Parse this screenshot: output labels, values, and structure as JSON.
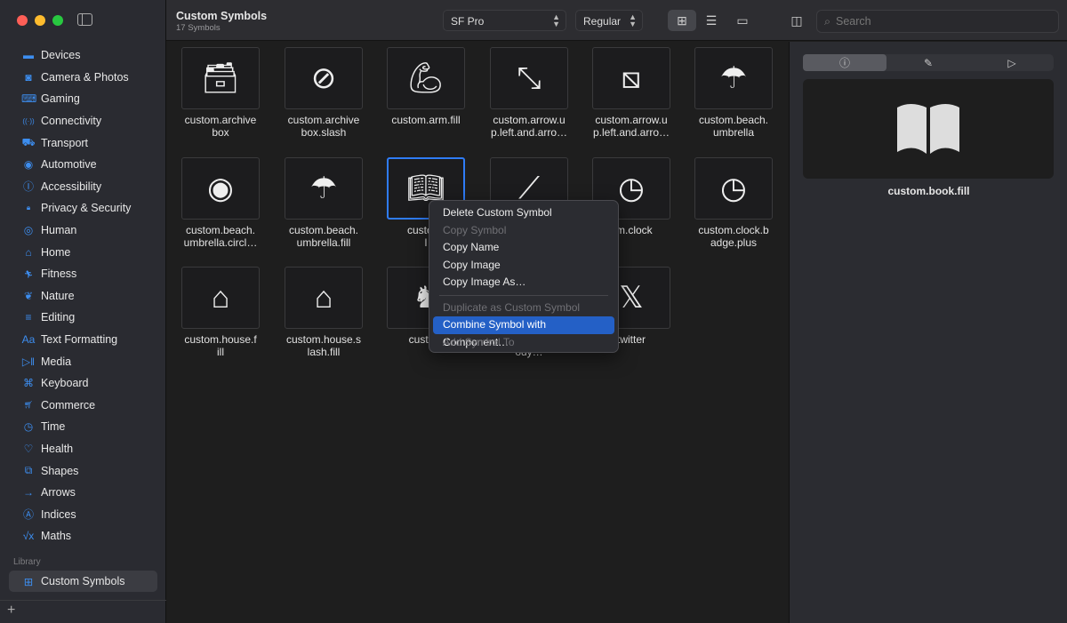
{
  "window": {
    "title": "Custom Symbols",
    "subtitle": "17 Symbols"
  },
  "toolbar": {
    "font": "SF Pro",
    "weight": "Regular",
    "search_placeholder": "Search",
    "view_modes": [
      "grid",
      "list",
      "gallery"
    ],
    "active_view": "grid"
  },
  "sidebar": {
    "items": [
      {
        "label": "Devices",
        "icon": "display-icon"
      },
      {
        "label": "Camera & Photos",
        "icon": "camera-icon"
      },
      {
        "label": "Gaming",
        "icon": "gamecontroller-icon"
      },
      {
        "label": "Connectivity",
        "icon": "antenna-icon"
      },
      {
        "label": "Transport",
        "icon": "car-icon"
      },
      {
        "label": "Automotive",
        "icon": "steeringwheel-icon"
      },
      {
        "label": "Accessibility",
        "icon": "accessibility-icon"
      },
      {
        "label": "Privacy & Security",
        "icon": "lock-icon"
      },
      {
        "label": "Human",
        "icon": "person-icon"
      },
      {
        "label": "Home",
        "icon": "house-icon"
      },
      {
        "label": "Fitness",
        "icon": "figure-run-icon"
      },
      {
        "label": "Nature",
        "icon": "leaf-icon"
      },
      {
        "label": "Editing",
        "icon": "sliders-icon"
      },
      {
        "label": "Text Formatting",
        "icon": "textformat-icon"
      },
      {
        "label": "Media",
        "icon": "playpause-icon"
      },
      {
        "label": "Keyboard",
        "icon": "command-icon"
      },
      {
        "label": "Commerce",
        "icon": "cart-icon"
      },
      {
        "label": "Time",
        "icon": "timer-icon"
      },
      {
        "label": "Health",
        "icon": "heart-icon"
      },
      {
        "label": "Shapes",
        "icon": "shapes-icon"
      },
      {
        "label": "Arrows",
        "icon": "arrow-right-icon"
      },
      {
        "label": "Indices",
        "icon": "a-circle-icon"
      },
      {
        "label": "Maths",
        "icon": "sqrt-icon"
      }
    ],
    "library_label": "Library",
    "library_item": "Custom Symbols"
  },
  "symbols": [
    {
      "label": "custom.archivebox",
      "l1": "custom.archive",
      "l2": "box",
      "icon": "archivebox-icon"
    },
    {
      "label": "custom.archivebox.slash",
      "l1": "custom.archive",
      "l2": "box.slash",
      "icon": "archivebox-slash-icon"
    },
    {
      "label": "custom.arm.fill",
      "l1": "custom.arm.fill",
      "l2": "",
      "icon": "arm-icon"
    },
    {
      "l1": "custom.arrow.u",
      "l2": "p.left.and.arro…",
      "icon": "arrow-diagonal-icon"
    },
    {
      "l1": "custom.arrow.u",
      "l2": "p.left.and.arro…",
      "icon": "arrow-diagonal-square-icon"
    },
    {
      "l1": "custom.beach.",
      "l2": "umbrella",
      "icon": "umbrella-icon"
    },
    {
      "l1": "custom.beach.",
      "l2": "umbrella.circl…",
      "icon": "umbrella-circle-icon"
    },
    {
      "l1": "custom.beach.",
      "l2": "umbrella.fill",
      "icon": "umbrella-fill-icon"
    },
    {
      "l1": "custom.",
      "l2": "l",
      "icon": "book-fill-icon",
      "selected": true
    },
    {
      "l1": "",
      "l2": "",
      "icon": "cigarette-icon"
    },
    {
      "l1": "om.clock",
      "l2": "",
      "icon": "clock-icon"
    },
    {
      "l1": "custom.clock.b",
      "l2": "adge.plus",
      "icon": "clock-badge-plus-icon"
    },
    {
      "l1": "custom.house.f",
      "l2": "ill",
      "icon": "house-fill-icon"
    },
    {
      "l1": "custom.house.s",
      "l2": "lash.fill",
      "icon": "house-slash-icon"
    },
    {
      "l1": "custom",
      "l2": "",
      "icon": "figure-icon"
    },
    {
      "l1": "",
      "l2": "ody…",
      "icon": "body-icon"
    },
    {
      "l1": "twitter",
      "l2": "",
      "icon": "x-logo-icon"
    }
  ],
  "context_menu": {
    "items": [
      {
        "label": "Delete Custom Symbol",
        "enabled": true
      },
      {
        "label": "Copy Symbol",
        "enabled": false
      },
      {
        "label": "Copy Name",
        "enabled": true
      },
      {
        "label": "Copy Image",
        "enabled": true
      },
      {
        "label": "Copy Image As…",
        "enabled": true
      },
      {
        "label": "Duplicate as Custom Symbol",
        "enabled": false
      },
      {
        "label": "Combine Symbol with Component…",
        "enabled": true,
        "highlighted": true
      },
      {
        "label": "Add Symbol To",
        "enabled": false
      }
    ]
  },
  "inspector": {
    "tabs": [
      "info-icon",
      "paintbrush-icon",
      "play-icon"
    ],
    "active_tab": "info",
    "symbol_name": "custom.book.fill"
  },
  "colors": {
    "accent": "#2f7cf6",
    "sidebar_icon": "#3d8ef0",
    "highlight": "#2460c6"
  }
}
